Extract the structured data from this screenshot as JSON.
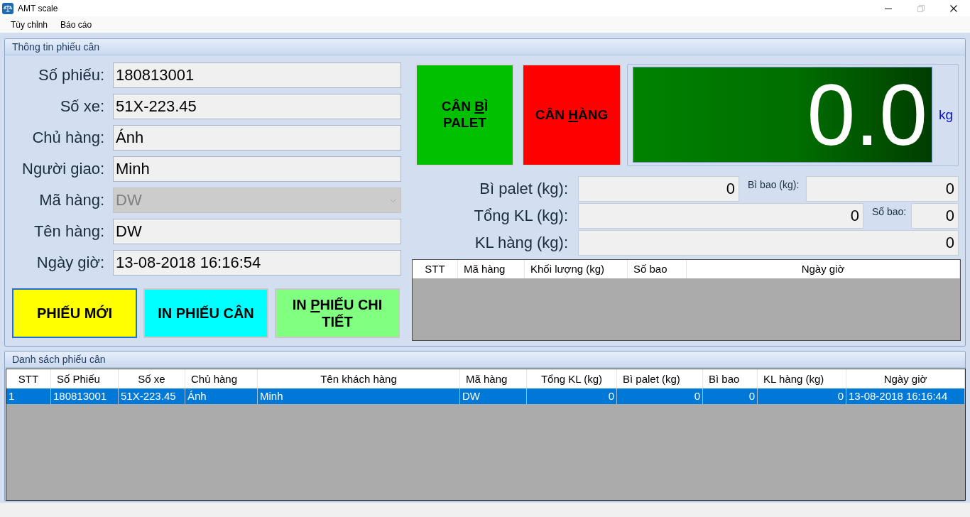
{
  "window": {
    "title": "AMT scale",
    "controls": [
      {
        "kind": "minimize",
        "disabled": false
      },
      {
        "kind": "restore",
        "disabled": true
      },
      {
        "kind": "close",
        "disabled": false
      }
    ]
  },
  "menu": [
    {
      "label": "Tùy chỉnh"
    },
    {
      "label": "Báo cáo"
    }
  ],
  "ticket_info": {
    "title": "Thông tin phiếu cân",
    "fields": [
      {
        "kind": "text",
        "label": "Số phiếu:",
        "value": "180813001",
        "disabled": false
      },
      {
        "kind": "text",
        "label": "Số xe:",
        "value": "51X-223.45",
        "disabled": false
      },
      {
        "kind": "text",
        "label": "Chủ hàng:",
        "value": "Ánh",
        "disabled": false
      },
      {
        "kind": "text",
        "label": "Người giao:",
        "value": "Minh",
        "disabled": false
      },
      {
        "kind": "dropdown",
        "label": "Mã hàng:",
        "value": "DW",
        "disabled": true
      },
      {
        "kind": "text",
        "label": "Tên hàng:",
        "value": "DW",
        "disabled": false
      },
      {
        "kind": "text",
        "label": "Ngày giờ:",
        "value": "13-08-2018 16:16:54",
        "disabled": false
      }
    ],
    "actions": [
      {
        "label_parts": [
          {
            "text": "PHIẾU MỚI",
            "underline": false
          }
        ],
        "color": "#ffff00",
        "focused": true
      },
      {
        "label_parts": [
          {
            "text": "IN PHIẾU CÂN",
            "underline": false
          }
        ],
        "color": "#00ffff",
        "focused": false
      },
      {
        "label_parts": [
          {
            "text": "IN ",
            "underline": false
          },
          {
            "text": "P",
            "underline": true
          },
          {
            "text": "HIẾU CHI TIẾT",
            "underline": false
          }
        ],
        "color": "#80ff80",
        "focused": false
      }
    ],
    "weigh_buttons": [
      {
        "label_parts": [
          {
            "text": "CÂN ",
            "underline": false
          },
          {
            "text": "B",
            "underline": true
          },
          {
            "text": "Ì PALET",
            "underline": false
          }
        ],
        "color": "#00c000"
      },
      {
        "label_parts": [
          {
            "text": "CÂN ",
            "underline": false
          },
          {
            "text": "H",
            "underline": true
          },
          {
            "text": "ÀNG",
            "underline": false
          }
        ],
        "color": "#ff0000"
      }
    ],
    "display": {
      "reading": "0.0",
      "unit": "kg"
    },
    "weights": [
      {
        "label": "Bì palet (kg):",
        "value": "0",
        "extra": {
          "label": "Bì bao (kg):",
          "value": "0"
        }
      },
      {
        "label": "Tổng KL (kg):",
        "value": "0",
        "extra": {
          "label": "Số bao:",
          "value": "0"
        }
      },
      {
        "label": "KL hàng (kg):",
        "value": "0"
      }
    ],
    "detail_table": {
      "columns": [
        "STT",
        "Mã hàng",
        "Khối lượng (kg)",
        "Số bao",
        "Ngày giờ"
      ]
    }
  },
  "ticket_list": {
    "title": "Danh sách phiếu cân",
    "table": {
      "columns": [
        "STT",
        "Số Phiếu",
        "Số xe",
        "Chủ hàng",
        "Tên khách hàng",
        "Mã hàng",
        "Tổng KL (kg)",
        "Bì palet (kg)",
        "Bì bao",
        "KL hàng (kg)",
        "Ngày giờ"
      ],
      "rows": [
        {
          "selected": true,
          "cells": [
            "1",
            "180813001",
            "51X-223.45",
            "Ánh",
            "Minh",
            "DW",
            "0",
            "0",
            "0",
            "0",
            "13-08-2018 16:16:44"
          ]
        }
      ]
    }
  }
}
